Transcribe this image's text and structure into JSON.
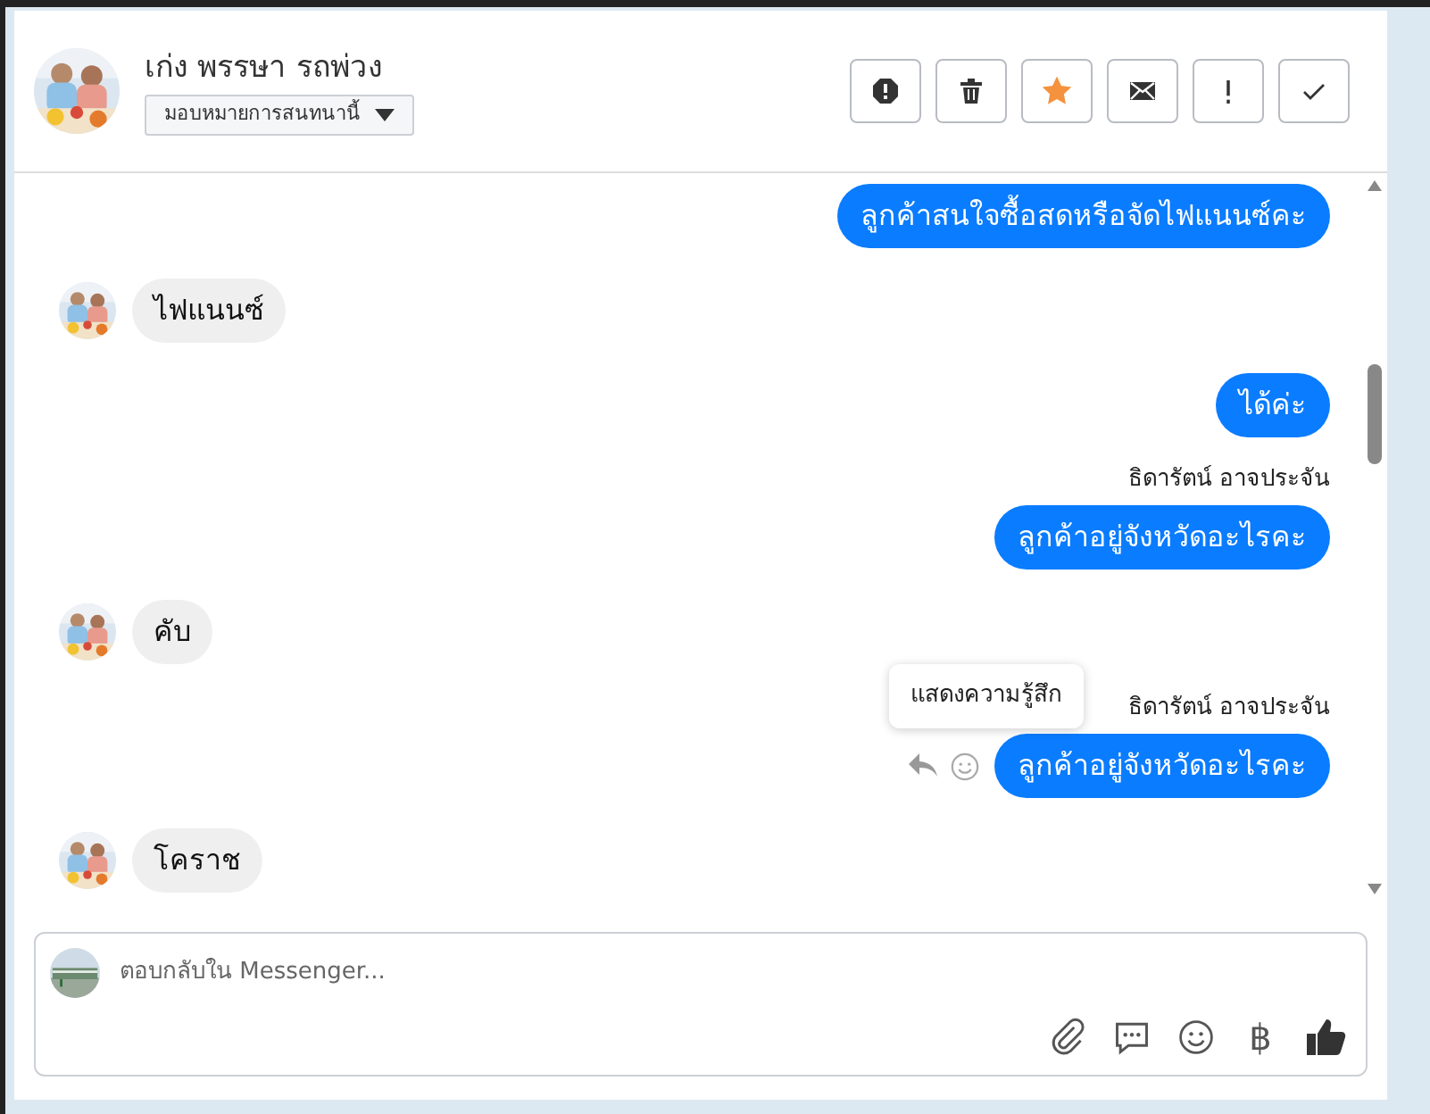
{
  "header": {
    "name": "เก่ง พรรษา รถพ่วง",
    "assign": "มอบหมายการสนทนานี้",
    "actions": [
      {
        "kind": "spam"
      },
      {
        "kind": "delete"
      },
      {
        "kind": "star",
        "on": true
      },
      {
        "kind": "mail"
      },
      {
        "kind": "important"
      },
      {
        "kind": "done"
      }
    ]
  },
  "messages": [
    {
      "kind": "outgoing",
      "text": "ลูกค้าสนใจซื้อสดหรือจัดไฟแนนซ์คะ"
    },
    {
      "kind": "incoming",
      "text": "ไฟแนนซ์"
    },
    {
      "kind": "outgoing",
      "text": "ได้ค่ะ"
    },
    {
      "kind": "outgoing",
      "sender": "ธิดารัตน์ อาจประจัน",
      "text": "ลูกค้าอยู่จังหวัดอะไรคะ"
    },
    {
      "kind": "incoming",
      "text": "คับ"
    },
    {
      "kind": "outgoing",
      "sender": "ธิดารัตน์ อาจประจัน",
      "text": "ลูกค้าอยู่จังหวัดอะไรคะ",
      "hovered": true,
      "tooltip": "แสดงความรู้สึก"
    },
    {
      "kind": "incoming",
      "text": "โคราช"
    }
  ],
  "composer": {
    "placeholder": "ตอบกลับใน Messenger...",
    "tools": [
      {
        "kind": "attach"
      },
      {
        "kind": "comment"
      },
      {
        "kind": "emoji"
      },
      {
        "kind": "baht",
        "label": "฿"
      },
      {
        "kind": "like"
      }
    ]
  }
}
